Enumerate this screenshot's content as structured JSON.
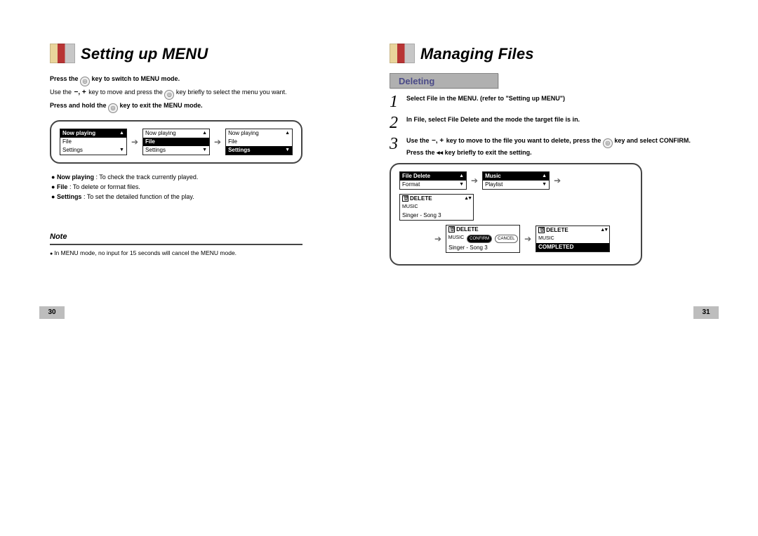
{
  "left": {
    "title": "Setting up MENU",
    "intro_line1_a": "Press the ",
    "intro_line1_b": " key to switch to MENU mode.",
    "intro_line2_a": "Use the ",
    "intro_line2_keys": "−, +",
    "intro_line2_b": " key to move and press the ",
    "intro_line2_c": " key briefly to select the menu you want.",
    "intro_line3_a": "Press and hold the ",
    "intro_line3_b": " key to exit the MENU mode.",
    "menu_items": [
      "Now playing",
      "File",
      "Settings"
    ],
    "bullets": [
      {
        "name": "Now playing",
        "desc": " : To check the track currently played."
      },
      {
        "name": "File",
        "desc": " : To delete or format  files."
      },
      {
        "name": "Settings",
        "desc": " : To set the detailed function of the play."
      }
    ],
    "note_label": "Note",
    "note_text": "In MENU mode, no input for 15 seconds will cancel the MENU mode.",
    "page_num": "30"
  },
  "right": {
    "title": "Managing Files",
    "section": "Deleting",
    "steps": [
      {
        "n": "1",
        "text": "Select File in the MENU. (refer to \"Setting up MENU\")"
      },
      {
        "n": "2",
        "text": "In File, select File Delete and the mode the target file is in."
      },
      {
        "n": "3",
        "text_a": "Use the ",
        "keys": "−, +",
        "text_b": " key to move to the file you want to delete, press the ",
        "text_c": " key and select CONFIRM.",
        "text_d": "Press the ",
        "rew": "◂◂",
        "text_e": " key briefly to exit the setting."
      }
    ],
    "screens": {
      "a": [
        "File Delete",
        "Format"
      ],
      "b": [
        "Music",
        "Playlist"
      ],
      "c_label": "DELETE",
      "c_sub": "MUSIC",
      "c_song": "Singer - Song 3",
      "d_label": "DELETE",
      "d_sub": "MUSIC",
      "d_song": "Singer - Song 3",
      "d_confirm": "CONFIRM",
      "d_cancel": "CANCEL",
      "e_label": "DELETE",
      "e_sub": "MUSIC",
      "e_status": "COMPLETED"
    },
    "page_num": "31"
  }
}
